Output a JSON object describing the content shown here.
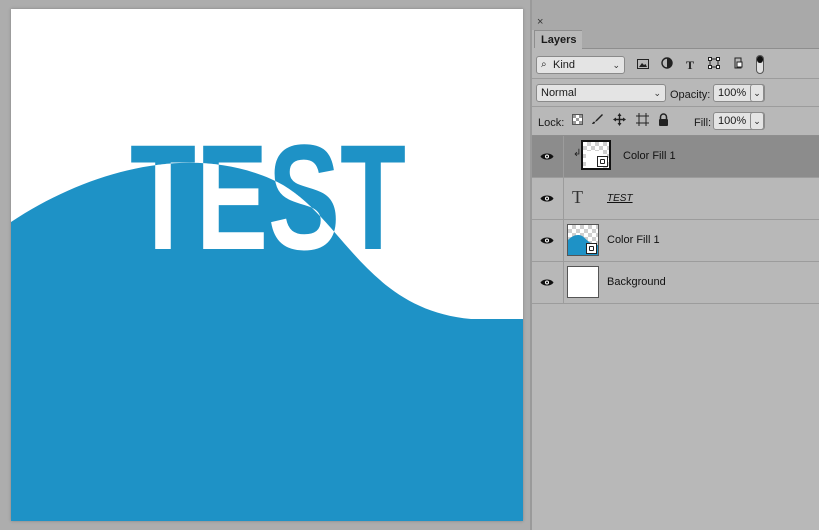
{
  "canvas": {
    "text": "TEST",
    "fill_color": "#1e92c6",
    "background_color": "#ffffff"
  },
  "panel": {
    "close_glyph": "×",
    "tab_label": "Layers",
    "filter": {
      "value": "Kind",
      "icons": [
        "image-filter-icon",
        "adjustment-filter-icon",
        "type-filter-icon",
        "shape-filter-icon",
        "smart-object-filter-icon",
        "filter-toggle"
      ]
    },
    "blend_mode": "Normal",
    "opacity_label": "Opacity:",
    "opacity_value": "100%",
    "lock_label": "Lock:",
    "fill_label": "Fill:",
    "fill_value": "100%"
  },
  "layers": [
    {
      "name": "Color Fill 1",
      "kind": "fill-clipped",
      "selected": true,
      "visible": true
    },
    {
      "name": "TEST",
      "kind": "type",
      "selected": false,
      "visible": true
    },
    {
      "name": "Color Fill 1",
      "kind": "fill",
      "selected": false,
      "visible": true
    },
    {
      "name": "Background",
      "kind": "background",
      "selected": false,
      "visible": true
    }
  ]
}
